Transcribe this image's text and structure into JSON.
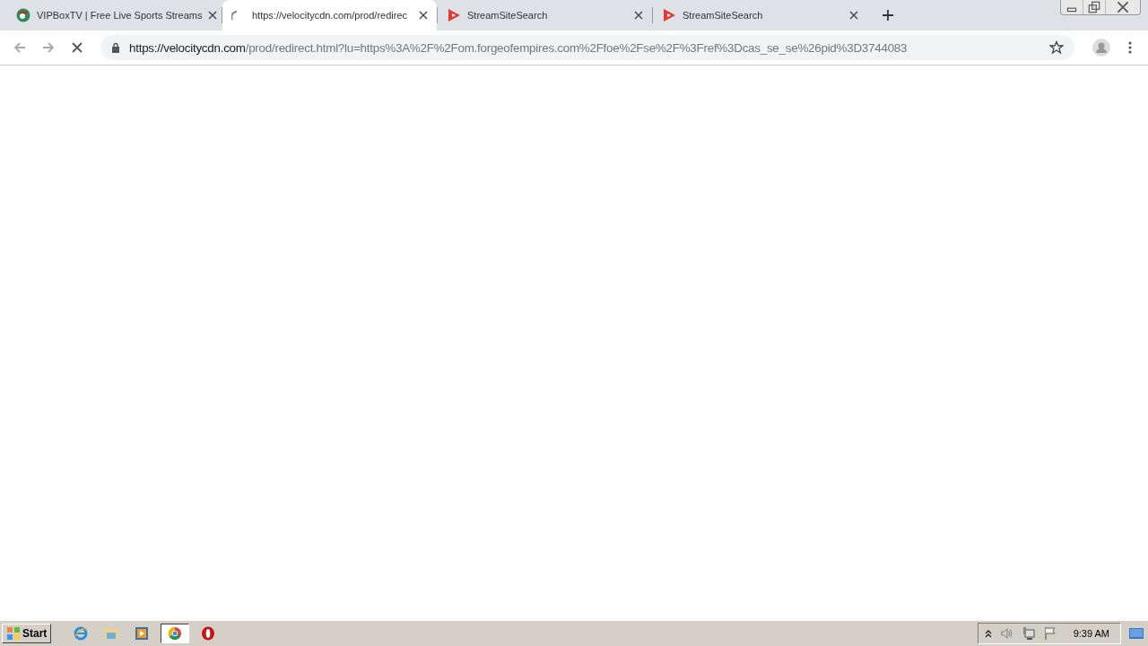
{
  "tabs": [
    {
      "title": "VIPBoxTV | Free Live Sports Streams",
      "kind": "ball",
      "selected": false
    },
    {
      "title": "https://velocitycdn.com/prod/redirec",
      "kind": "spinner",
      "selected": true
    },
    {
      "title": "StreamSiteSearch",
      "kind": "play",
      "selected": false
    },
    {
      "title": "StreamSiteSearch",
      "kind": "play",
      "selected": false
    }
  ],
  "toolbar": {
    "loading": true,
    "url_host": "https://velocitycdn.com",
    "url_path": "/prod/redirect.html?lu=https%3A%2F%2Fom.forgeofempires.com%2Ffoe%2Fse%2F%3Fref%3Dcas_se_se%26pid%3D3744083"
  },
  "taskbar": {
    "start": "Start",
    "apps": [
      {
        "kind": "ie",
        "selected": false
      },
      {
        "kind": "folder",
        "selected": false
      },
      {
        "kind": "media",
        "selected": false
      },
      {
        "kind": "chrome",
        "selected": true
      },
      {
        "kind": "opera",
        "selected": false
      }
    ],
    "clock": "9:39 AM"
  }
}
